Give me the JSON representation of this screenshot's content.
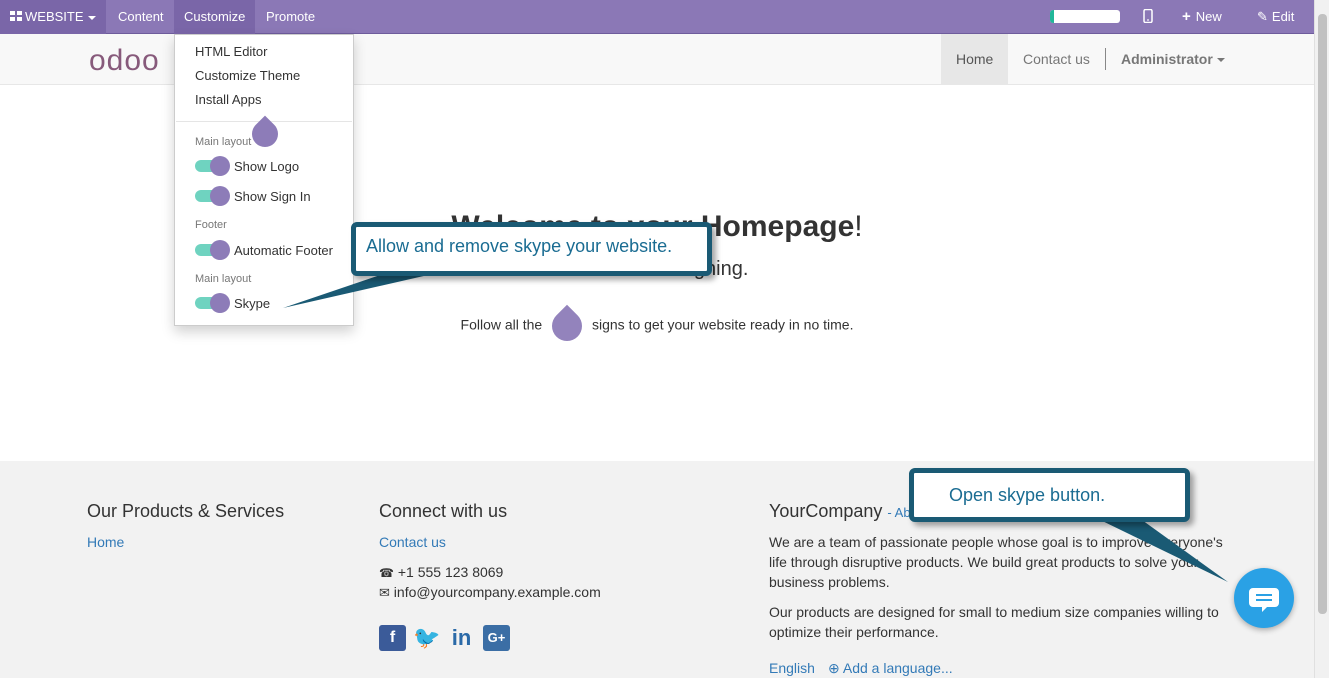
{
  "topbar": {
    "website_label": "WEBSITE",
    "content_label": "Content",
    "customize_label": "Customize",
    "promote_label": "Promote",
    "progress_fraction": 0.05,
    "new_label": "New",
    "edit_label": "Edit"
  },
  "header": {
    "logo_text": "odoo",
    "nav": [
      "Home",
      "Contact us"
    ],
    "user": "Administrator"
  },
  "dropdown": {
    "links": [
      "HTML Editor",
      "Customize Theme",
      "Install Apps"
    ],
    "sections": [
      {
        "header": "Main layout",
        "toggles": [
          {
            "label": "Show Logo",
            "on": true
          },
          {
            "label": "Show Sign In",
            "on": true
          }
        ]
      },
      {
        "header": "Footer",
        "toggles": [
          {
            "label": "Automatic Footer",
            "on": true
          }
        ]
      },
      {
        "header": "Main layout",
        "toggles": [
          {
            "label": "Skype",
            "on": true
          }
        ]
      }
    ]
  },
  "main": {
    "title_prefix": "Welcome to your ",
    "title_bold": "Homepage",
    "title_suffix": "!",
    "subtitle": "Let's start designing.",
    "follow_before": "Follow all the",
    "follow_after": "signs to get your website ready in no time."
  },
  "callouts": {
    "skype_toggle": "Allow and remove skype your website.",
    "skype_button": "Open skype button."
  },
  "footer": {
    "col1": {
      "heading": "Our Products & Services",
      "links": [
        "Home"
      ]
    },
    "col2": {
      "heading": "Connect with us",
      "link": "Contact us",
      "phone": "+1 555 123 8069",
      "email": "info@yourcompany.example.com",
      "social": [
        "facebook",
        "twitter",
        "linkedin",
        "google-plus"
      ]
    },
    "col3": {
      "heading": "YourCompany",
      "heading_small": "- Ab",
      "para1": "We are a team of passionate people whose goal is to improve everyone's life through disruptive products. We build great products to solve your business problems.",
      "para2": "Our products are designed for small to medium size companies willing to optimize their performance.",
      "lang": "English",
      "add_lang": "Add a language..."
    }
  },
  "colors": {
    "topbar": "#8b78b6",
    "accent_teal": "#6fd3c0",
    "callout_border": "#1a5a74",
    "chat_button": "#2aa1e5",
    "link": "#337ab7"
  }
}
